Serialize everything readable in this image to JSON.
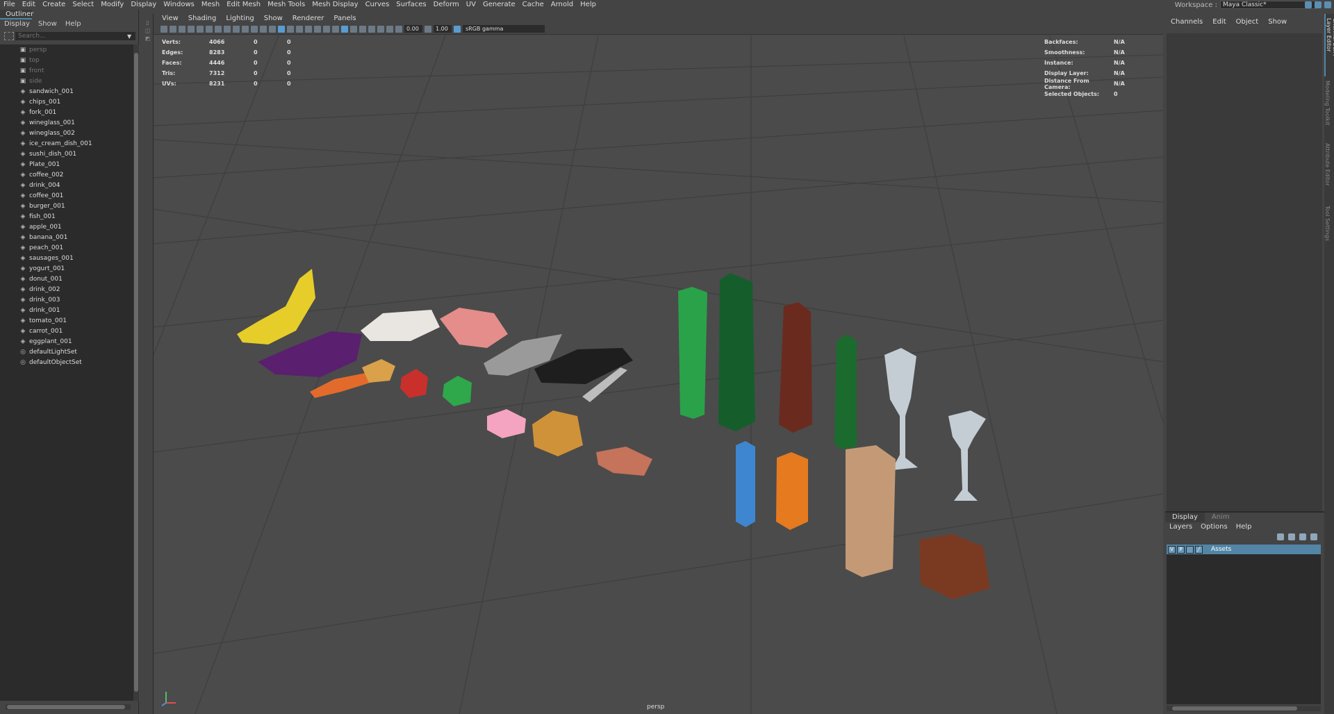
{
  "menubar": {
    "items": [
      "File",
      "Edit",
      "Create",
      "Select",
      "Modify",
      "Display",
      "Windows",
      "Mesh",
      "Edit Mesh",
      "Mesh Tools",
      "Mesh Display",
      "Curves",
      "Surfaces",
      "Deform",
      "UV",
      "Generate",
      "Cache",
      "Arnold",
      "Help"
    ],
    "workspace_label": "Workspace :",
    "workspace_value": "Maya Classic*"
  },
  "outliner": {
    "title": "Outliner",
    "menu": [
      "Display",
      "Show",
      "Help"
    ],
    "search_placeholder": "Search...",
    "items": [
      {
        "name": "persp",
        "kind": "camera"
      },
      {
        "name": "top",
        "kind": "camera"
      },
      {
        "name": "front",
        "kind": "camera"
      },
      {
        "name": "side",
        "kind": "camera"
      },
      {
        "name": "sandwich_001",
        "kind": "mesh"
      },
      {
        "name": "chips_001",
        "kind": "mesh"
      },
      {
        "name": "fork_001",
        "kind": "mesh"
      },
      {
        "name": "wineglass_001",
        "kind": "mesh"
      },
      {
        "name": "wineglass_002",
        "kind": "mesh"
      },
      {
        "name": "ice_cream_dish_001",
        "kind": "mesh"
      },
      {
        "name": "sushi_dish_001",
        "kind": "mesh"
      },
      {
        "name": "Plate_001",
        "kind": "mesh"
      },
      {
        "name": "coffee_002",
        "kind": "mesh"
      },
      {
        "name": "drink_004",
        "kind": "mesh"
      },
      {
        "name": "coffee_001",
        "kind": "mesh"
      },
      {
        "name": "burger_001",
        "kind": "mesh"
      },
      {
        "name": "fish_001",
        "kind": "mesh"
      },
      {
        "name": "apple_001",
        "kind": "mesh"
      },
      {
        "name": "banana_001",
        "kind": "mesh"
      },
      {
        "name": "peach_001",
        "kind": "mesh"
      },
      {
        "name": "sausages_001",
        "kind": "mesh"
      },
      {
        "name": "yogurt_001",
        "kind": "mesh"
      },
      {
        "name": "donut_001",
        "kind": "mesh"
      },
      {
        "name": "drink_002",
        "kind": "mesh"
      },
      {
        "name": "drink_003",
        "kind": "mesh"
      },
      {
        "name": "drink_001",
        "kind": "mesh"
      },
      {
        "name": "tomato_001",
        "kind": "mesh"
      },
      {
        "name": "carrot_001",
        "kind": "mesh"
      },
      {
        "name": "eggplant_001",
        "kind": "mesh"
      },
      {
        "name": "defaultLightSet",
        "kind": "set"
      },
      {
        "name": "defaultObjectSet",
        "kind": "set"
      }
    ]
  },
  "viewport": {
    "menu": [
      "View",
      "Shading",
      "Lighting",
      "Show",
      "Renderer",
      "Panels"
    ],
    "exposure": "0.00",
    "gamma": "1.00",
    "colorspace": "sRGB gamma",
    "camera_label": "persp",
    "hud_left": [
      {
        "label": "Verts:",
        "val": "4066",
        "a": "0",
        "b": "0"
      },
      {
        "label": "Edges:",
        "val": "8283",
        "a": "0",
        "b": "0"
      },
      {
        "label": "Faces:",
        "val": "4446",
        "a": "0",
        "b": "0"
      },
      {
        "label": "Tris:",
        "val": "7312",
        "a": "0",
        "b": "0"
      },
      {
        "label": "UVs:",
        "val": "8231",
        "a": "0",
        "b": "0"
      }
    ],
    "hud_right": [
      {
        "label": "Backfaces:",
        "val": "N/A"
      },
      {
        "label": "Smoothness:",
        "val": "N/A"
      },
      {
        "label": "Instance:",
        "val": "N/A"
      },
      {
        "label": "Display Layer:",
        "val": "N/A"
      },
      {
        "label": "Distance From Camera:",
        "val": "N/A"
      },
      {
        "label": "Selected Objects:",
        "val": "0"
      }
    ]
  },
  "channel_box": {
    "menu": [
      "Channels",
      "Edit",
      "Object",
      "Show"
    ]
  },
  "layer_editor": {
    "tabs": [
      "Display",
      "Anim"
    ],
    "menu": [
      "Layers",
      "Options",
      "Help"
    ],
    "layer": {
      "v": "V",
      "p": "P",
      "name": "Assets"
    }
  },
  "side_tabs": [
    "Channel Box / Layer Editor",
    "Modeling Toolkit",
    "Attribute Editor",
    "Tool Settings"
  ],
  "colors": {
    "accent": "#5285a6",
    "bg": "#444444",
    "viewport": "#4a4a4a",
    "panel_dark": "#2b2b2b"
  }
}
